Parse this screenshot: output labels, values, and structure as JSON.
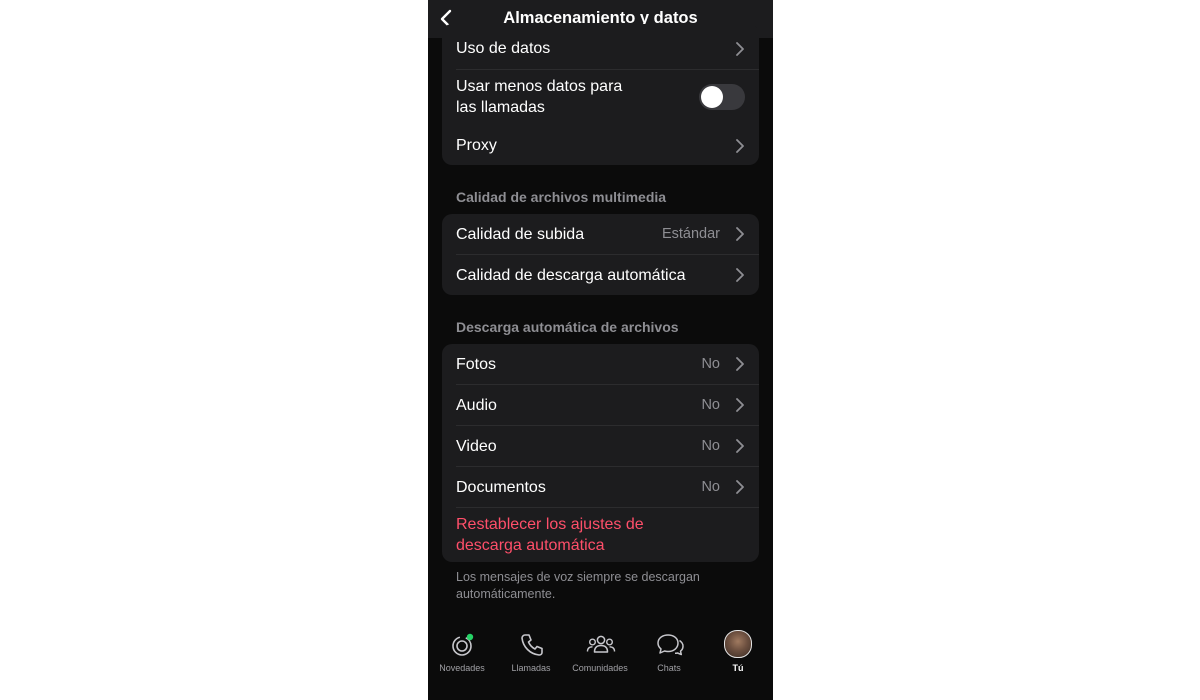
{
  "header": {
    "title": "Almacenamiento y datos",
    "back_icon": "chevron-left-icon"
  },
  "network_group": {
    "data_usage_label": "Uso de datos",
    "less_data_label_line1": "Usar menos datos para",
    "less_data_label_line2": "las llamadas",
    "less_data_enabled": false,
    "proxy_label": "Proxy"
  },
  "media_quality": {
    "section_title": "Calidad de archivos multimedia",
    "upload_label": "Calidad de subida",
    "upload_value": "Estándar",
    "auto_download_quality_label": "Calidad de descarga automática"
  },
  "auto_download": {
    "section_title": "Descarga automática de archivos",
    "items": [
      {
        "label": "Fotos",
        "value": "No"
      },
      {
        "label": "Audio",
        "value": "No"
      },
      {
        "label": "Video",
        "value": "No"
      },
      {
        "label": "Documentos",
        "value": "No"
      }
    ],
    "reset_line1": "Restablecer los ajustes de",
    "reset_line2": "descarga automática",
    "footnote": "Los mensajes de voz siempre se descargan automáticamente."
  },
  "tabbar": {
    "items": [
      {
        "label": "Novedades",
        "icon": "status-icon"
      },
      {
        "label": "Llamadas",
        "icon": "phone-icon"
      },
      {
        "label": "Comunidades",
        "icon": "communities-icon"
      },
      {
        "label": "Chats",
        "icon": "chats-icon"
      },
      {
        "label": "Tú",
        "icon": "avatar",
        "active": true
      }
    ]
  },
  "colors": {
    "background": "#0b0b0b",
    "card": "#1c1c1e",
    "destructive": "#ff4f6a",
    "secondary_text": "#8e8e93",
    "status_dot": "#25d366"
  }
}
